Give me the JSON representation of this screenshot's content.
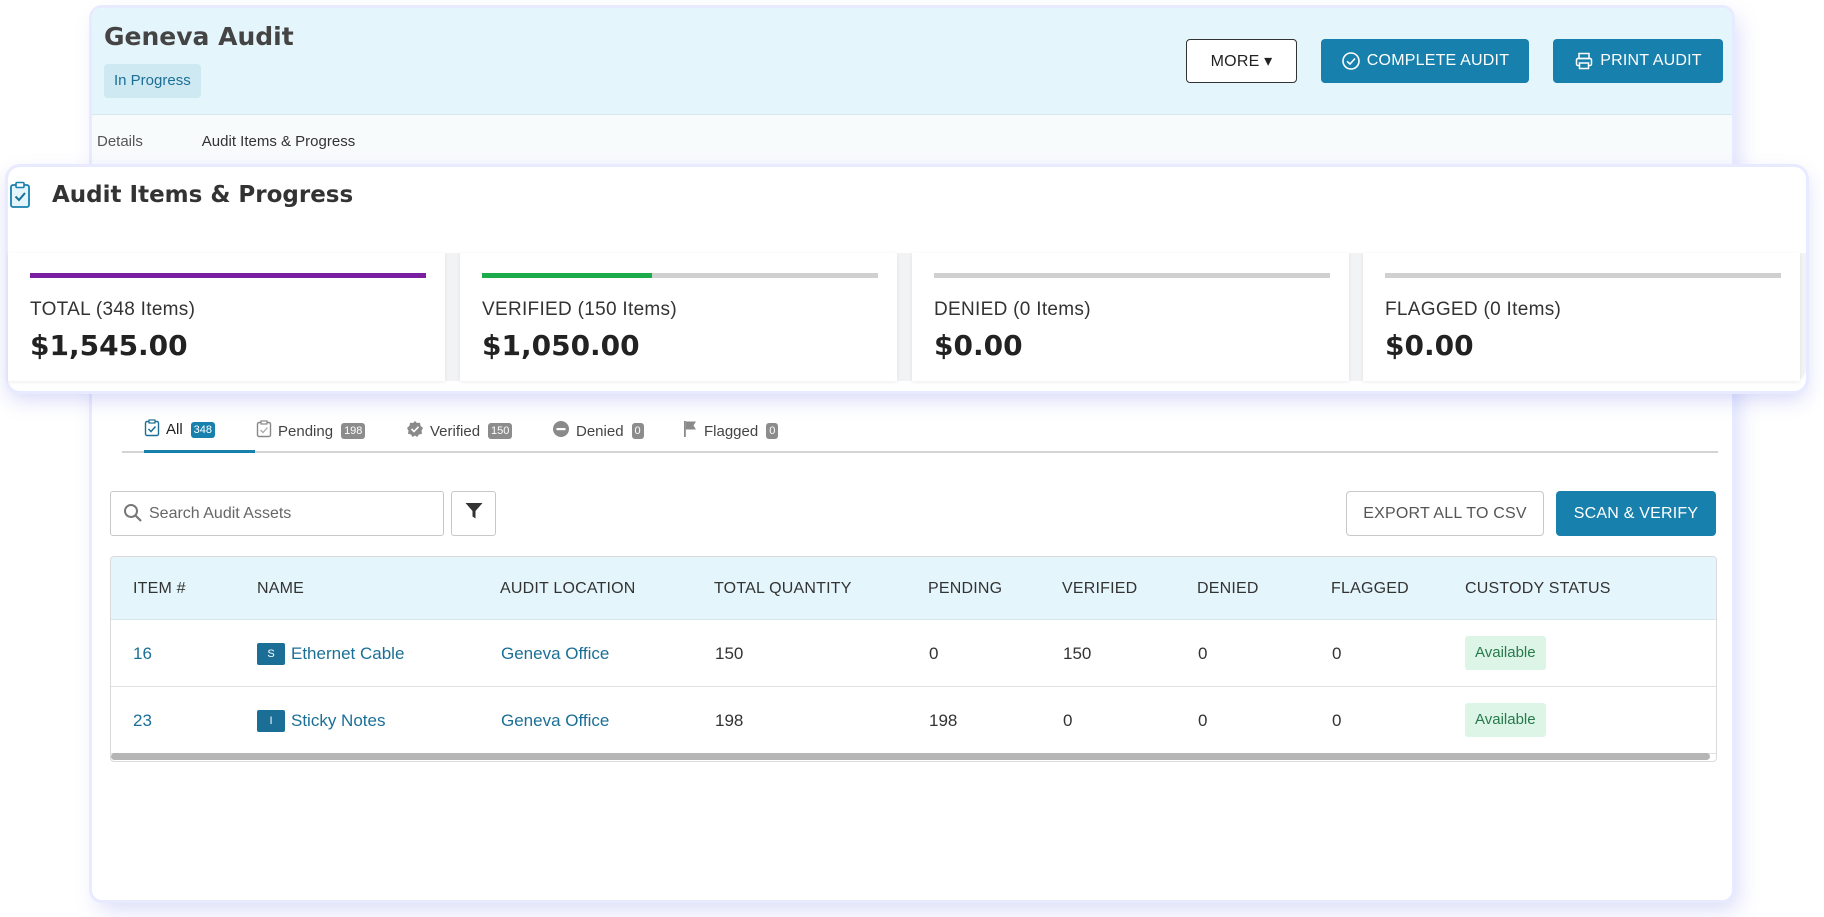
{
  "header": {
    "title": "Geneva Audit",
    "status": "In Progress",
    "more_label": "MORE ▾",
    "complete_label": "COMPLETE AUDIT",
    "print_label": "PRINT AUDIT",
    "complete_icon": "check-circle-icon",
    "print_icon": "printer-icon"
  },
  "tabs": {
    "details": "Details",
    "items": "Audit Items & Progress"
  },
  "summary": {
    "title": "Audit Items & Progress",
    "icon": "clipboard-check-icon",
    "cards": [
      {
        "label": "TOTAL (348 Items)",
        "value": "$1,545.00",
        "progress": 1.0,
        "color": "#7a1fa2"
      },
      {
        "label": "VERIFIED (150 Items)",
        "value": "$1,050.00",
        "progress": 0.43,
        "color": "#1cab4b"
      },
      {
        "label": "DENIED (0 Items)",
        "value": "$0.00",
        "progress": 0,
        "color": "#d0d0d0"
      },
      {
        "label": "FLAGGED (0 Items)",
        "value": "$0.00",
        "progress": 0,
        "color": "#d0d0d0"
      }
    ]
  },
  "filter_tabs": [
    {
      "label": "All",
      "count": "348",
      "icon": "clipboard-check-icon"
    },
    {
      "label": "Pending",
      "count": "198",
      "icon": "clipboard-icon"
    },
    {
      "label": "Verified",
      "count": "150",
      "icon": "verified-badge-icon"
    },
    {
      "label": "Denied",
      "count": "0",
      "icon": "minus-circle-icon"
    },
    {
      "label": "Flagged",
      "count": "0",
      "icon": "flag-icon"
    }
  ],
  "toolbar": {
    "search_placeholder": "Search Audit Assets",
    "search_value": "",
    "export_label": "EXPORT ALL TO CSV",
    "scan_label": "SCAN & VERIFY"
  },
  "table": {
    "columns": [
      "ITEM #",
      "NAME",
      "AUDIT LOCATION",
      "TOTAL QUANTITY",
      "PENDING",
      "VERIFIED",
      "DENIED",
      "FLAGGED",
      "CUSTODY STATUS"
    ],
    "rows": [
      {
        "item": "16",
        "type": "S",
        "name": "Ethernet Cable",
        "location": "Geneva Office",
        "total": "150",
        "pending": "0",
        "verified": "150",
        "denied": "0",
        "flagged": "0",
        "status": "Available"
      },
      {
        "item": "23",
        "type": "I",
        "name": "Sticky Notes",
        "location": "Geneva Office",
        "total": "198",
        "pending": "198",
        "verified": "0",
        "denied": "0",
        "flagged": "0",
        "status": "Available"
      }
    ]
  },
  "colors": {
    "accent": "#1780ad",
    "header_bg": "#e4f5fb",
    "available_bg": "#dcf5e6",
    "available_text": "#287a4d"
  }
}
